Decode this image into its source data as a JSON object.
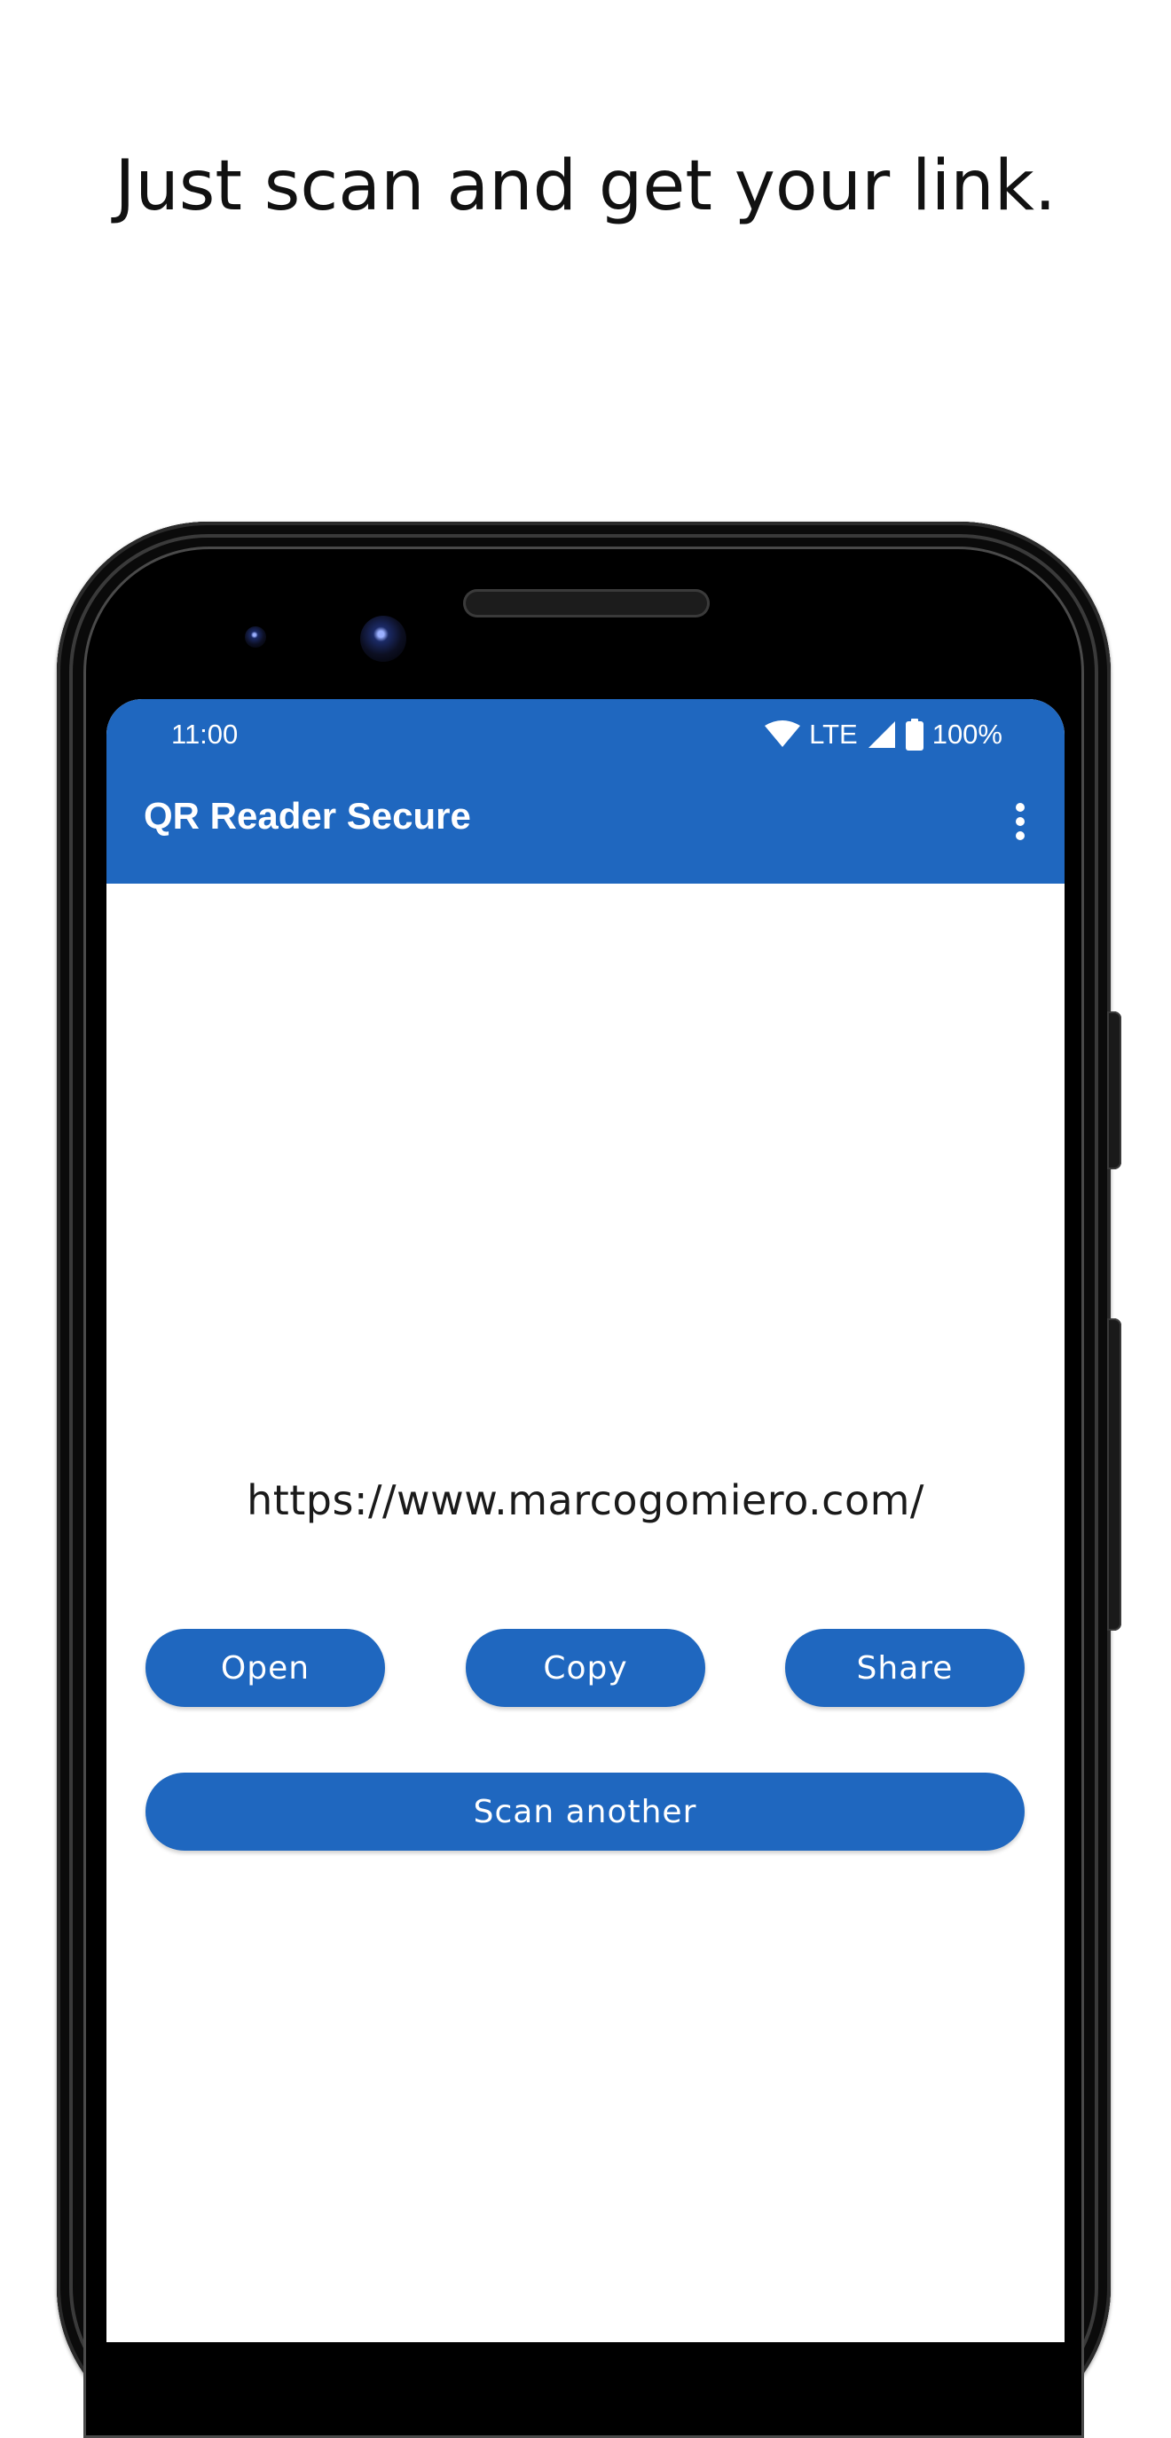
{
  "headline": "Just scan and get your link.",
  "status_bar": {
    "time": "11:00",
    "network": "LTE",
    "battery": "100%",
    "icons": [
      "wifi-icon",
      "cellular-signal-icon",
      "battery-icon"
    ]
  },
  "app_bar": {
    "title": "QR Reader Secure",
    "overflow_icon": "more-vert-icon"
  },
  "result": {
    "url": "https://www.marcogomiero.com/"
  },
  "actions": {
    "open_label": "Open",
    "copy_label": "Copy",
    "share_label": "Share",
    "scan_another_label": "Scan another"
  },
  "colors": {
    "primary": "#1f67bf",
    "on_primary": "#ffffff",
    "background": "#ffffff",
    "text": "#1a1a1a"
  }
}
